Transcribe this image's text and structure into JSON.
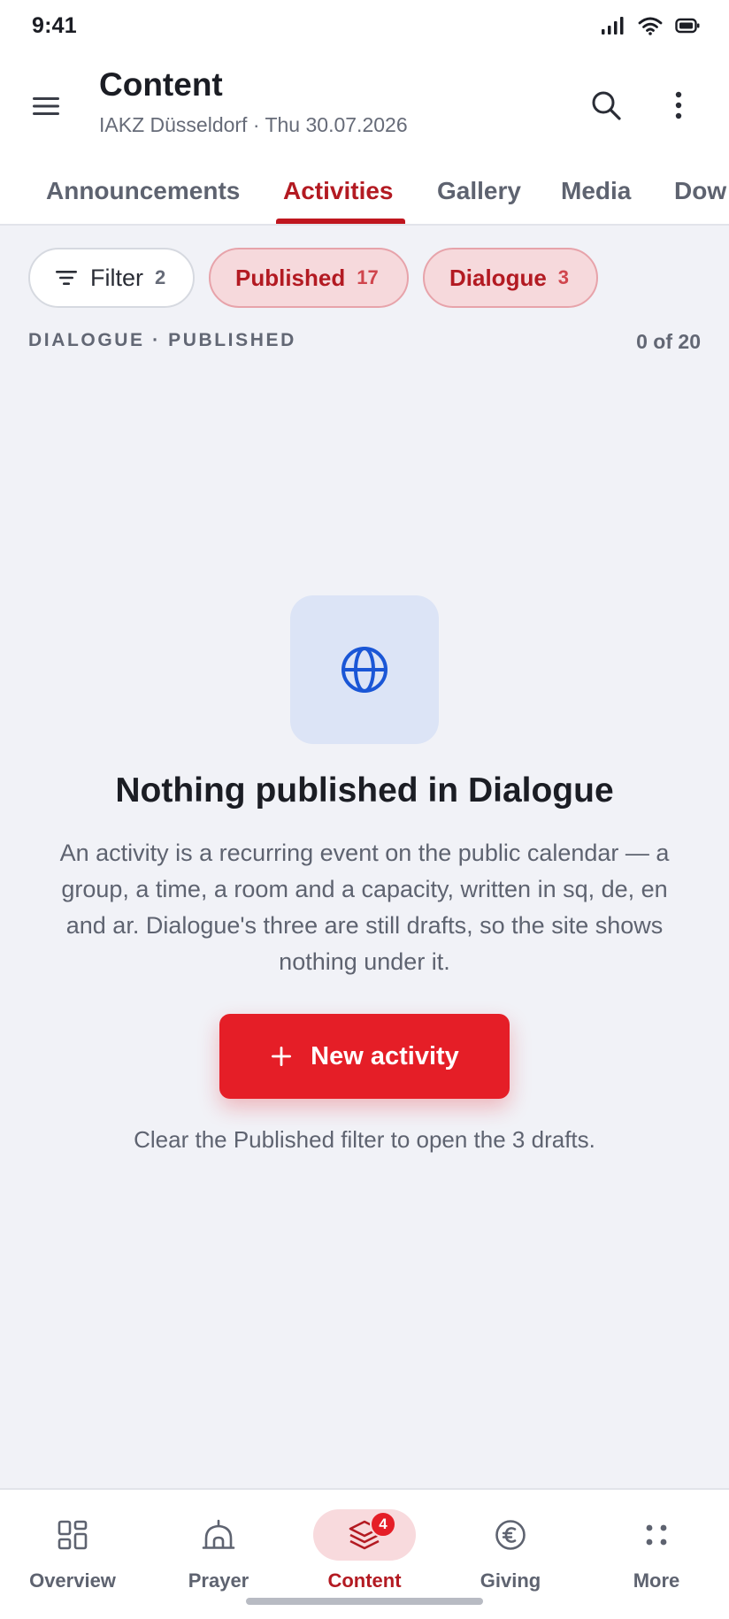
{
  "status": {
    "time": "9:41"
  },
  "header": {
    "title": "Content",
    "subtitle": "IAKZ Düsseldorf · Thu 30.07.2026"
  },
  "tabs": [
    {
      "label": "Announcements",
      "active": false
    },
    {
      "label": "Activities",
      "active": true
    },
    {
      "label": "Gallery",
      "active": false
    },
    {
      "label": "Media",
      "active": false
    },
    {
      "label": "Dow",
      "active": false
    }
  ],
  "filters": {
    "filter": {
      "label": "Filter",
      "count": "2"
    },
    "published": {
      "label": "Published",
      "count": "17"
    },
    "dialogue": {
      "label": "Dialogue",
      "count": "3"
    }
  },
  "list": {
    "section_label": "DIALOGUE · PUBLISHED",
    "count_label": "0 of 20"
  },
  "empty_state": {
    "icon": "globe-icon",
    "title": "Nothing published in Dialogue",
    "body": "An activity is a recurring event on the public calendar — a group, a time, a room and a capacity, written in sq, de, en and ar. Dialogue's three are still drafts, so the site shows nothing under it.",
    "button_label": "New activity",
    "hint": "Clear the Published filter to open the 3 drafts."
  },
  "bottom_nav": {
    "items": [
      {
        "label": "Overview",
        "icon": "dashboard-icon"
      },
      {
        "label": "Prayer",
        "icon": "mosque-icon"
      },
      {
        "label": "Content",
        "icon": "layers-icon",
        "badge": "4",
        "active": true
      },
      {
        "label": "Giving",
        "icon": "euro-icon"
      },
      {
        "label": "More",
        "icon": "dots-grid-icon"
      }
    ]
  },
  "colors": {
    "accent": "#E51E27",
    "accent_dark": "#B31A22",
    "chip_bg": "#F6D9DC",
    "icon_box_bg": "#DCE4F6",
    "globe_blue": "#1A56D6",
    "background": "#F1F2F7"
  }
}
